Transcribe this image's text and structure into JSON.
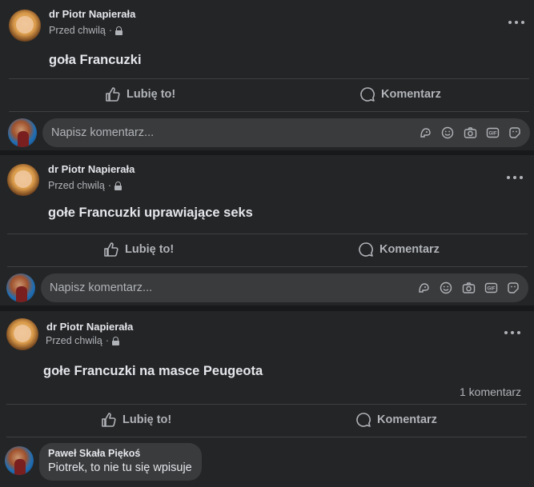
{
  "posts": [
    {
      "author": "dr Piotr Napierała",
      "time": "Przed chwilą",
      "separator": "·",
      "text": "goła Francuzki",
      "comment_count": "",
      "like_label": "Lubię to!",
      "comment_label": "Komentarz",
      "comment_placeholder": "Napisz komentarz..."
    },
    {
      "author": "dr Piotr Napierała",
      "time": "Przed chwilą",
      "separator": "·",
      "text": "gołe Francuzki uprawiające seks",
      "comment_count": "",
      "like_label": "Lubię to!",
      "comment_label": "Komentarz",
      "comment_placeholder": "Napisz komentarz..."
    },
    {
      "author": "dr Piotr Napierała",
      "time": "Przed chwilą",
      "separator": "·",
      "text": "gołe Francuzki na masce Peugeota",
      "comment_count": "1 komentarz",
      "like_label": "Lubię to!",
      "comment_label": "Komentarz",
      "comment_placeholder": ""
    }
  ],
  "comment": {
    "author": "Paweł Skała Piękoś",
    "text": "Piotrek, to nie tu się wpisuje"
  },
  "icons": {
    "privacy": "lock-icon",
    "more": "more-options-icon",
    "like": "thumbs-up-icon",
    "comment": "speech-bubble-icon",
    "composer": [
      "avatar-sticker-icon",
      "emoji-icon",
      "camera-icon",
      "gif-icon",
      "sticker-icon"
    ]
  },
  "colors": {
    "background": "#18191a",
    "card": "#242526",
    "input": "#3a3b3c",
    "text_primary": "#e4e6eb",
    "text_secondary": "#b0b3b8"
  }
}
